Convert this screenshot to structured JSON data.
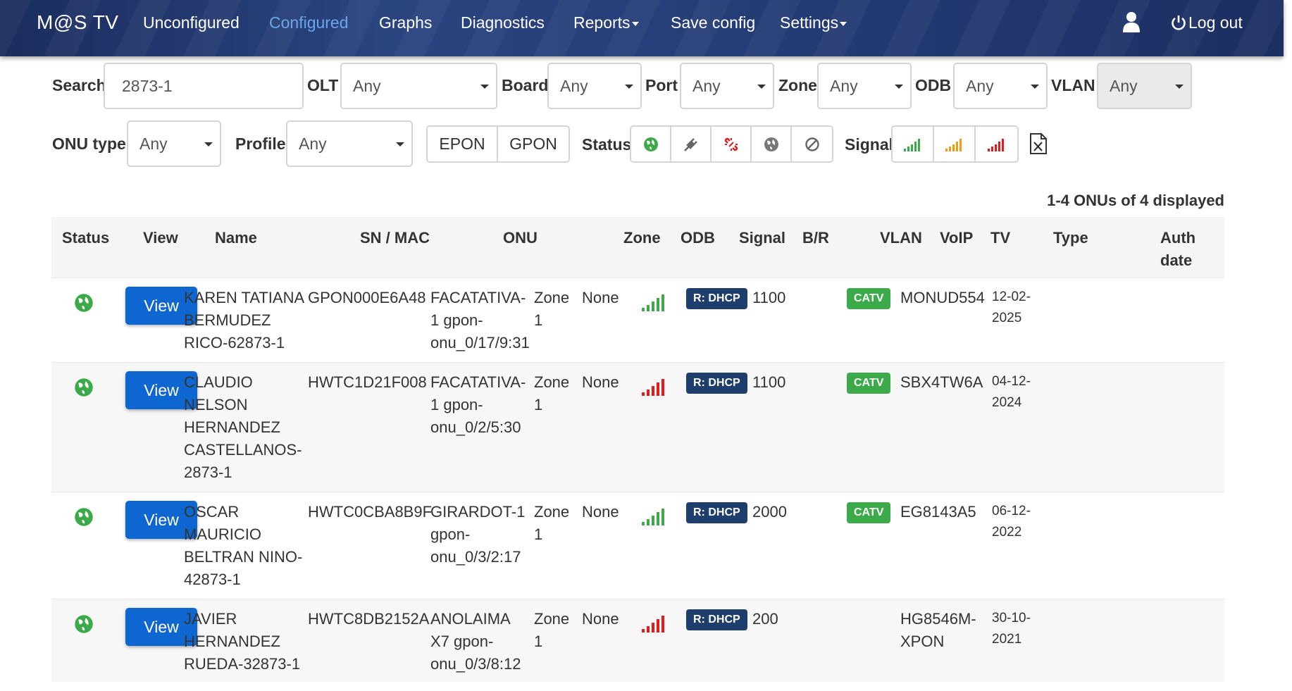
{
  "nav": {
    "brand": "M@S TV",
    "items": [
      "Unconfigured",
      "Configured",
      "Graphs",
      "Diagnostics",
      "Reports",
      "Save config",
      "Settings"
    ],
    "logout": "Log out"
  },
  "filters": {
    "search_label": "Search",
    "search_value": "2873-1",
    "olt_label": "OLT",
    "olt_value": "Any",
    "board_label": "Board",
    "board_value": "Any",
    "port_label": "Port",
    "port_value": "Any",
    "zone_label": "Zone",
    "zone_value": "Any",
    "odb_label": "ODB",
    "odb_value": "Any",
    "vlan_label": "VLAN",
    "vlan_value": "Any",
    "onu_type_label": "ONU type",
    "onu_type_value": "Any",
    "profile_label": "Profile",
    "profile_value": "Any",
    "epon": "EPON",
    "gpon": "GPON",
    "status_label": "Status",
    "signal_label": "Signal"
  },
  "count_text": "1-4 ONUs of 4 displayed",
  "columns": [
    "Status",
    "View",
    "Name",
    "SN / MAC",
    "ONU",
    "Zone",
    "ODB",
    "Signal",
    "B/R",
    "VLAN",
    "VoIP",
    "TV",
    "Type",
    "Auth date"
  ],
  "rows": [
    {
      "view": "View",
      "name": [
        "KAREN TATIANA",
        "BERMUDEZ",
        "RICO-62873-1"
      ],
      "sn": "GPON000E6A48",
      "onu": [
        "FACATATIVA-",
        "1 gpon-",
        "onu_0/17/9:31"
      ],
      "zone": [
        "Zone",
        "1"
      ],
      "odb": "None",
      "signal": "good",
      "br": "R: DHCP",
      "vlan": "1100",
      "tv": "CATV",
      "type": [
        "MONUD554"
      ],
      "auth": [
        "12-02-",
        "2025"
      ]
    },
    {
      "view": "View",
      "name": [
        "CLAUDIO",
        "NELSON",
        "HERNANDEZ",
        "CASTELLANOS-",
        "2873-1"
      ],
      "sn": "HWTC1D21F008",
      "onu": [
        "FACATATIVA-",
        "1 gpon-",
        "onu_0/2/5:30"
      ],
      "zone": [
        "Zone",
        "1"
      ],
      "odb": "None",
      "signal": "critical",
      "br": "R: DHCP",
      "vlan": "1100",
      "tv": "CATV",
      "type": [
        "SBX4TW6A"
      ],
      "auth": [
        "04-12-",
        "2024"
      ]
    },
    {
      "view": "View",
      "name": [
        "OSCAR",
        "MAURICIO",
        "BELTRAN NINO-",
        "42873-1"
      ],
      "sn": "HWTC0CBA8B9F",
      "onu": [
        "GIRARDOT-1",
        "gpon-",
        "onu_0/3/2:17"
      ],
      "zone": [
        "Zone",
        "1"
      ],
      "odb": "None",
      "signal": "good",
      "br": "R: DHCP",
      "vlan": "2000",
      "tv": "CATV",
      "type": [
        "EG8143A5"
      ],
      "auth": [
        "06-12-",
        "2022"
      ]
    },
    {
      "view": "View",
      "name": [
        "JAVIER",
        "HERNANDEZ",
        "RUEDA-32873-1"
      ],
      "sn": "HWTC8DB2152A",
      "onu": [
        "ANOLAIMA",
        "X7 gpon-",
        "onu_0/3/8:12"
      ],
      "zone": [
        "Zone",
        "1"
      ],
      "odb": "None",
      "signal": "critical",
      "br": "R: DHCP",
      "vlan": "200",
      "tv": "",
      "type": [
        "HG8546M-",
        "XPON"
      ],
      "auth": [
        "30-10-",
        "2021"
      ]
    }
  ],
  "colors": {
    "nav_bg": "#223a72",
    "active_nav": "#6aa6e8",
    "view_button": "#0e66d0",
    "online_green": "#3daa4a",
    "signal_warning": "#f29b17",
    "signal_critical": "#e31b1b",
    "br_badge": "#1e3f6e"
  },
  "icons": {
    "status_filters": [
      "online-globe-icon",
      "power-fail-plug-icon",
      "los-broken-link-icon",
      "offline-globe-icon",
      "disabled-icon"
    ],
    "signal_filters": [
      "signal-good-icon",
      "signal-warning-icon",
      "signal-critical-icon"
    ],
    "export": "excel-export-icon"
  }
}
